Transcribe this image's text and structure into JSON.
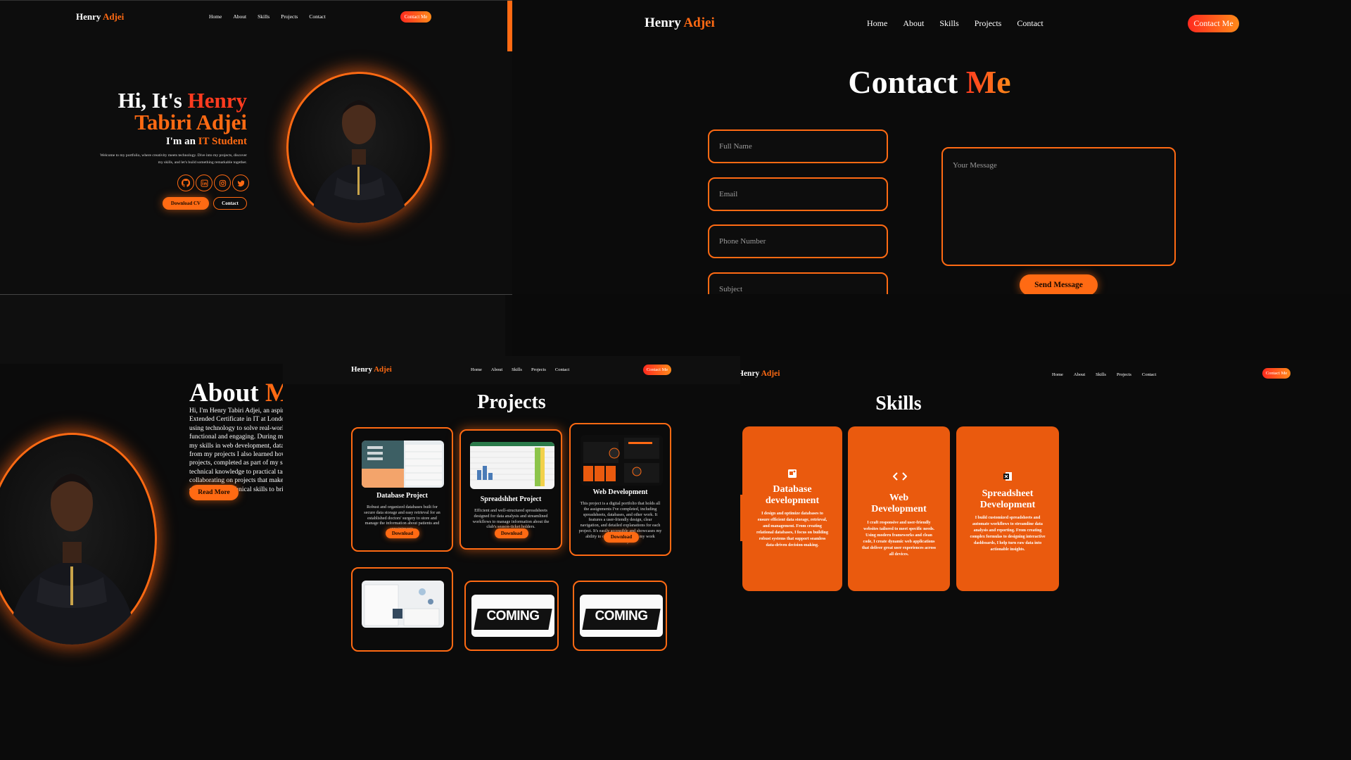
{
  "brand": {
    "first": "Henry",
    "second": "Adjei"
  },
  "nav": {
    "home": "Home",
    "about": "About",
    "skills": "Skills",
    "projects": "Projects",
    "contact": "Contact",
    "cta": "Contact Me"
  },
  "hero": {
    "greeting": "Hi, It's",
    "first_name": "Henry",
    "rest_name": "Tabiri Adjei",
    "role_prefix": "I'm an",
    "role": "IT Student",
    "intro_line1": "Welcome to my portfolio, where creativity meets technology. Dive into my projects, discover",
    "intro_line2": "my skills, and let's build something remarkable together.",
    "social_icons": [
      "github-icon",
      "linkedin-icon",
      "instagram-icon",
      "twitter-icon"
    ],
    "download_cv": "Download CV",
    "contact_button": "Contact"
  },
  "contact": {
    "title_a": "Contact",
    "title_b": "Me",
    "full_name": "Full Name",
    "email": "Email",
    "phone": "Phone Number",
    "subject": "Subject",
    "message": "Your Message",
    "send": "Send Message"
  },
  "about": {
    "title_a": "About",
    "title_b": "Me",
    "lines": [
      "Hi, I'm Henry Tabiri Adjei, an aspiring I",
      "Extended Certificate in IT at London Sc",
      "using technology to solve real-world pro",
      "functional and engaging. During my co",
      "my skills in web development, database",
      "from my projects I also learned how the",
      "projects, completed as part of my schoo",
      "technical knowledge to practical tasks. I",
      "collaborating on projects that make a di",
      "creativity and technical skills to bring id"
    ],
    "read_more": "Read More"
  },
  "projects": {
    "title": "Projects",
    "cards": [
      {
        "title": "Database Project",
        "desc": "Robust and organized databases built for secure data storage and easy retrieval for an established doctors' surgery to store and manage the information about patients and appointments.",
        "button": "Download"
      },
      {
        "title": "Spreadshhet Project",
        "desc": "Efficient and well-structured spreadsheets designed for data analysis and streamlined workflows to manage information about the club's season-ticket holders.",
        "button": "Download"
      },
      {
        "title": "Web Development",
        "desc": "This project is a digital portfolio that holds all the assignments I've completed, including spreadsheets, databases, and other work. It features a user-friendly design, clear navigation, and detailed explanations for each project. It's easily accessible and showcases my ability to organize and present my work effectively.",
        "button": "Download"
      }
    ],
    "coming": "COMING"
  },
  "skills": {
    "title": "Skills",
    "cards": [
      {
        "icon": "database-icon",
        "title_l1": "Database",
        "title_l2": "development",
        "desc": "I design and optimize databases to ensure efficient data storage, retrieval, and management. From creating relational databases, I focus on building robust systems that support seamless data-driven decision-making."
      },
      {
        "icon": "code-icon",
        "title_l1": "Web",
        "title_l2": "Development",
        "desc": "I craft responsive and user-friendly websites tailored to meet specific needs. Using modern frameworks and clean code, I create dynamic web applications that deliver great user experiences across all devices."
      },
      {
        "icon": "excel-icon",
        "title_l1": "Spreadsheet",
        "title_l2": "Development",
        "desc": "I build customized spreadsheets and automate workflows to streamline data analysis and reporting. From creating complex formulas to designing interactive dashboards, I help turn raw data into actionable insights."
      }
    ]
  },
  "colors": {
    "accent": "#ff6a13",
    "accent_red": "#ff3b1f",
    "skill_card": "#ea5a0e",
    "background": "#0d0d0d"
  }
}
